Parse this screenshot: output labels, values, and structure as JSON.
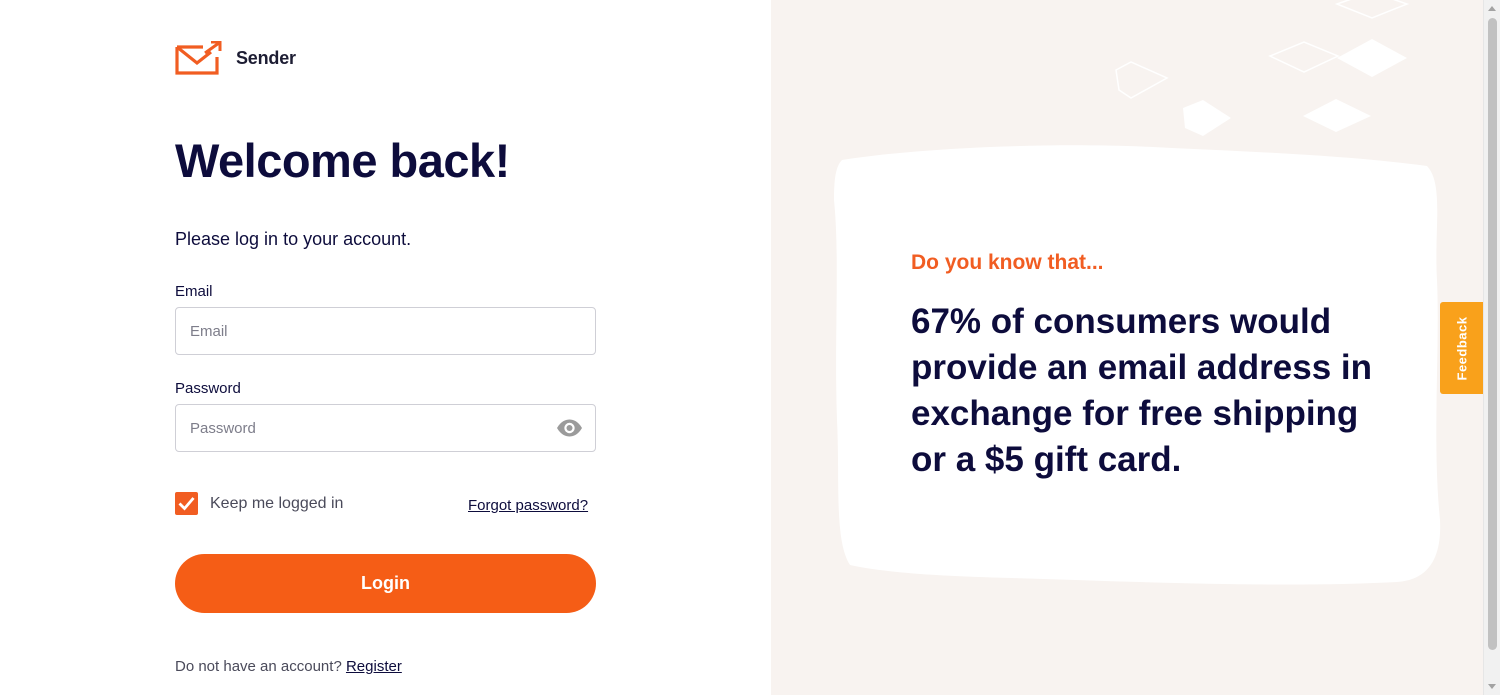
{
  "brand": {
    "name": "Sender",
    "accent_color": "#f55d16",
    "text_color": "#0d0c3c"
  },
  "login": {
    "title": "Welcome back!",
    "subtitle": "Please log in to your account.",
    "email_label": "Email",
    "email_placeholder": "Email",
    "email_value": "",
    "password_label": "Password",
    "password_placeholder": "Password",
    "password_value": "",
    "password_toggle_icon": "eye-icon",
    "keep_logged_in_label": "Keep me logged in",
    "keep_logged_in_checked": true,
    "forgot_password": "Forgot password?",
    "login_button": "Login",
    "register_prompt": "Do not have an account?",
    "register_link": "Register"
  },
  "promo": {
    "heading": "Do you know that...",
    "text": "67% of consumers would provide an email address in exchange for free shipping or a $5 gift card."
  },
  "feedback_tab": "Feedback"
}
